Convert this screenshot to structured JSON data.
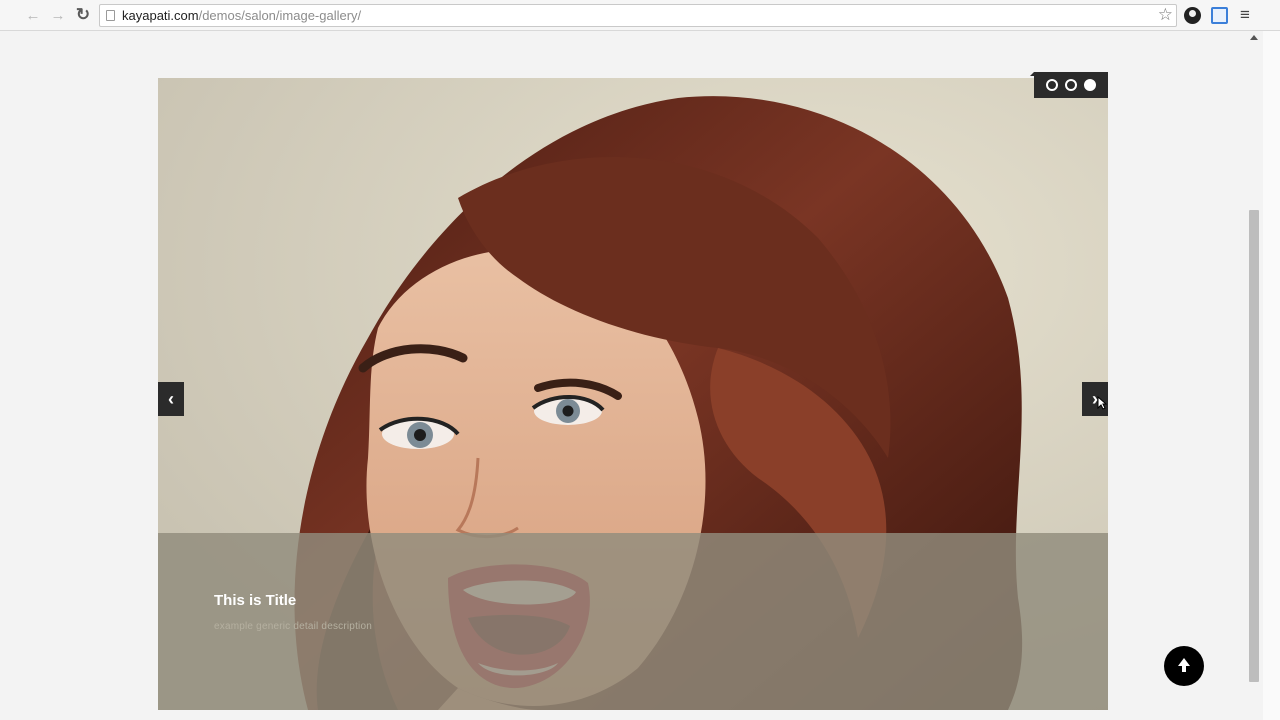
{
  "browser": {
    "url_host": "kayapati.com",
    "url_path": "/demos/salon/image-gallery/",
    "back_icon": "back-arrow-icon",
    "forward_icon": "forward-arrow-icon",
    "reload_icon": "reload-icon",
    "star_icon": "bookmark-star-icon",
    "menu_icon": "hamburger-menu-icon"
  },
  "gallery": {
    "slide": {
      "title": "This is Title",
      "description": "example generic detail description"
    },
    "dots": {
      "count": 3,
      "active": 3
    },
    "prev_icon": "chevron-left-icon",
    "next_icon": "chevron-right-icon"
  },
  "back_to_top": {
    "icon": "arrow-up-icon"
  },
  "colors": {
    "arrow_bg": "#2b2b2b",
    "caption_band": "#918c7d",
    "hair": "#6b2e1e"
  }
}
